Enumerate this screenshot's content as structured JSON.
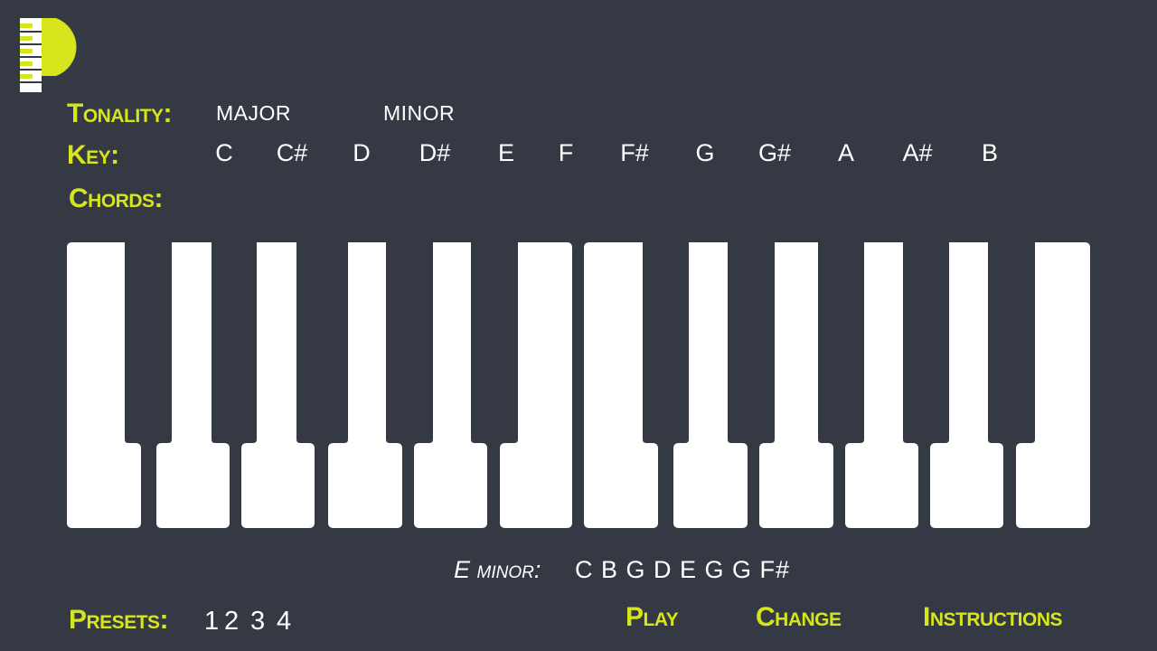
{
  "colors": {
    "background": "#343943",
    "accent": "#d6e51c",
    "key_white": "#ffffff"
  },
  "logo": {
    "letter": "P",
    "icon": "piano-logo"
  },
  "tonality": {
    "label": "Tonality:",
    "options": [
      "MAJOR",
      "MINOR"
    ]
  },
  "key": {
    "label": "Key:",
    "options": [
      "C",
      "C#",
      "D",
      "D#",
      "E",
      "F",
      "F#",
      "G",
      "G#",
      "A",
      "A#",
      "B"
    ]
  },
  "chords": {
    "label": "Chords:"
  },
  "piano": {
    "white_key_count": 12
  },
  "current_chord": {
    "name": "E minor:",
    "notes": "C B G D E G G F#"
  },
  "presets": {
    "label": "Presets:",
    "items": [
      "1",
      "2",
      "3",
      "4"
    ]
  },
  "actions": {
    "play": "Play",
    "change": "Change",
    "instructions": "Instructions"
  }
}
